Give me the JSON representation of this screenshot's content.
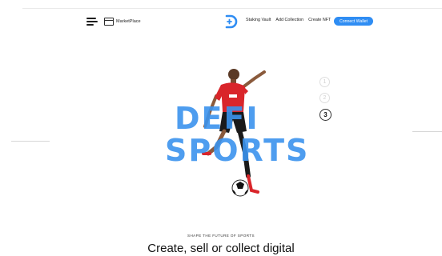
{
  "nav": {
    "marketplace_label": "MarketPlace",
    "links": [
      "Staking Vault",
      "Add Collection",
      "Create NFT"
    ],
    "connect_label": "Connect Wallet"
  },
  "hero": {
    "title_line1": "DEFI",
    "title_line2": "SPORTS",
    "tagline": "SHAPE THE FUTURE OF SPORTS",
    "headline": "Create, sell or collect digital",
    "pager": [
      "1",
      "2",
      "3"
    ],
    "pager_active": "3"
  },
  "colors": {
    "accent": "#2f8df3",
    "title": "#3b93ee",
    "jersey": "#d9252a"
  }
}
